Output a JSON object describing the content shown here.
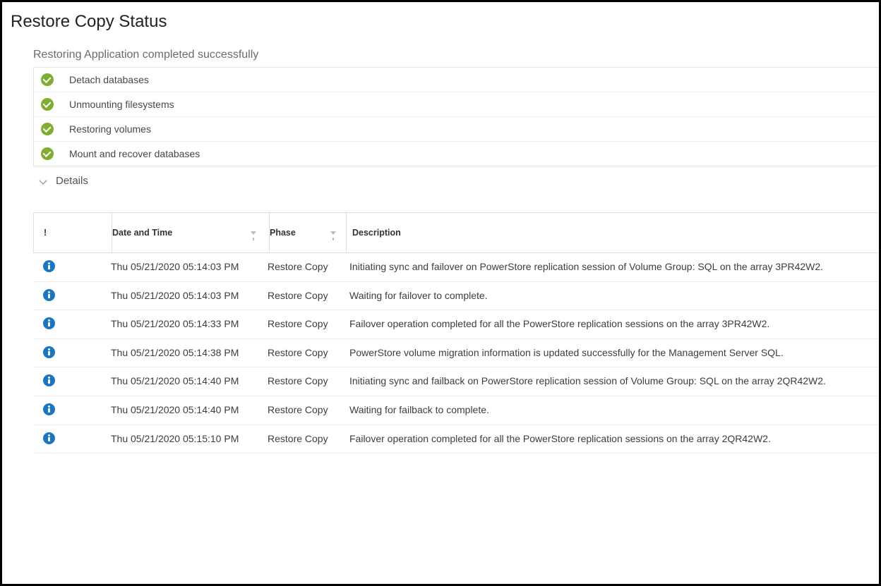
{
  "title": "Restore Copy Status",
  "subheading": "Restoring Application completed successfully",
  "steps": [
    {
      "label": "Detach databases"
    },
    {
      "label": "Unmounting filesystems"
    },
    {
      "label": "Restoring volumes"
    },
    {
      "label": "Mount and recover databases"
    }
  ],
  "details_label": "Details",
  "table": {
    "headers": {
      "status": "!",
      "date_time": "Date and Time",
      "phase": "Phase",
      "description": "Description"
    },
    "rows": [
      {
        "date": "Thu 05/21/2020 05:14:03 PM",
        "phase": "Restore Copy",
        "description": "Initiating sync and failover on PowerStore replication session of Volume Group: SQL on the array 3PR42W2."
      },
      {
        "date": "Thu 05/21/2020 05:14:03 PM",
        "phase": "Restore Copy",
        "description": "Waiting for failover to complete."
      },
      {
        "date": "Thu 05/21/2020 05:14:33 PM",
        "phase": "Restore Copy",
        "description": "Failover operation completed for all the PowerStore replication sessions on the array 3PR42W2."
      },
      {
        "date": "Thu 05/21/2020 05:14:38 PM",
        "phase": "Restore Copy",
        "description": "PowerStore volume migration information is updated successfully for the Management Server SQL."
      },
      {
        "date": "Thu 05/21/2020 05:14:40 PM",
        "phase": "Restore Copy",
        "description": "Initiating sync and failback on PowerStore replication session of Volume Group: SQL on the array 2QR42W2."
      },
      {
        "date": "Thu 05/21/2020 05:14:40 PM",
        "phase": "Restore Copy",
        "description": "Waiting for failback to complete."
      },
      {
        "date": "Thu 05/21/2020 05:15:10 PM",
        "phase": "Restore Copy",
        "description": "Failover operation completed for all the PowerStore replication sessions on the array 2QR42W2."
      }
    ]
  }
}
